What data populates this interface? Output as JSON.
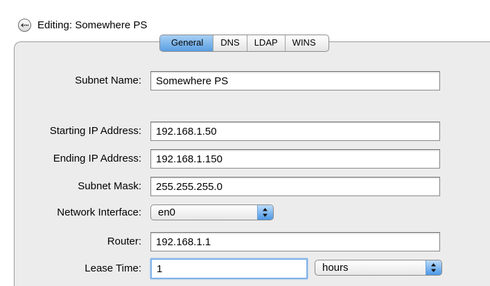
{
  "window": {
    "title": "Editing: Somewhere PS"
  },
  "tabs": [
    {
      "label": "General",
      "active": true
    },
    {
      "label": "DNS",
      "active": false
    },
    {
      "label": "LDAP",
      "active": false
    },
    {
      "label": "WINS",
      "active": false
    }
  ],
  "form": {
    "subnet_name": {
      "label": "Subnet Name:",
      "value": "Somewhere PS"
    },
    "starting_ip": {
      "label": "Starting IP Address:",
      "value": "192.168.1.50"
    },
    "ending_ip": {
      "label": "Ending IP Address:",
      "value": "192.168.1.150"
    },
    "subnet_mask": {
      "label": "Subnet Mask:",
      "value": "255.255.255.0"
    },
    "network_interface": {
      "label": "Network Interface:",
      "value": "en0"
    },
    "router": {
      "label": "Router:",
      "value": "192.168.1.1"
    },
    "lease_time": {
      "label": "Lease Time:",
      "value": "1",
      "unit": "hours"
    }
  },
  "colors": {
    "panel": "#ececec",
    "accent": "#5a9fe2",
    "focus_ring": "#7eb1e8"
  },
  "icons": {
    "back": "back-arrows-icon",
    "popup": "updown-arrows-icon"
  }
}
